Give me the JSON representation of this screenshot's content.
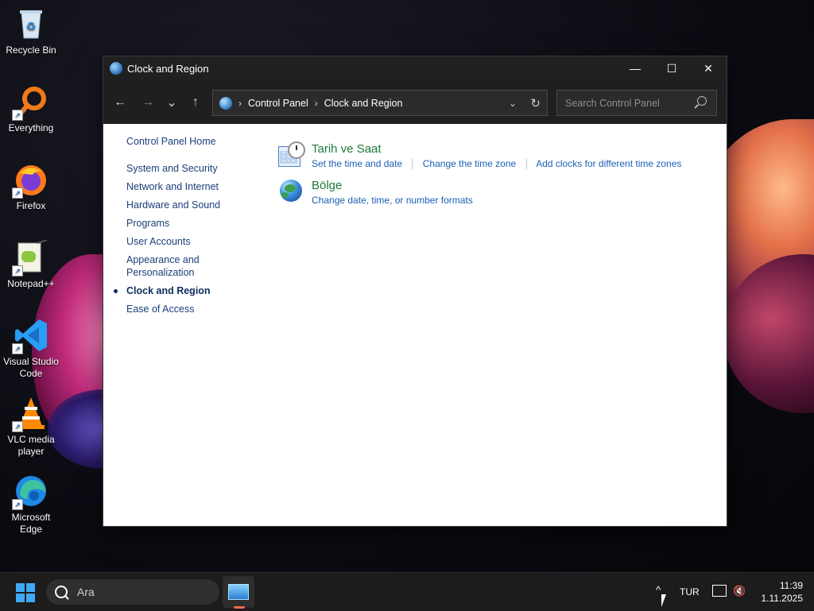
{
  "desktop": {
    "icons": [
      {
        "label": "Recycle Bin",
        "icon": "recycle-bin-icon"
      },
      {
        "label": "Everything",
        "icon": "everything-search-icon"
      },
      {
        "label": "Firefox",
        "icon": "firefox-icon"
      },
      {
        "label": "Notepad++",
        "icon": "notepadpp-icon"
      },
      {
        "label": "Visual Studio Code",
        "icon": "vscode-icon"
      },
      {
        "label": "VLC media player",
        "icon": "vlc-icon"
      },
      {
        "label": "Microsoft Edge",
        "icon": "edge-icon"
      }
    ]
  },
  "window": {
    "title": "Clock and Region",
    "controls": {
      "minimize": "—",
      "maximize": "☐",
      "close": "✕"
    }
  },
  "navbar": {
    "back": "←",
    "forward": "→",
    "recent": "⌄",
    "up": "↑",
    "breadcrumb": [
      "Control Panel",
      "Clock and Region"
    ],
    "separator": "›",
    "search_placeholder": "Search Control Panel"
  },
  "sidebar": {
    "home": "Control Panel Home",
    "items": [
      {
        "label": "System and Security",
        "current": false
      },
      {
        "label": "Network and Internet",
        "current": false
      },
      {
        "label": "Hardware and Sound",
        "current": false
      },
      {
        "label": "Programs",
        "current": false
      },
      {
        "label": "User Accounts",
        "current": false
      },
      {
        "label": "Appearance and Personalization",
        "current": false
      },
      {
        "label": "Clock and Region",
        "current": true
      },
      {
        "label": "Ease of Access",
        "current": false
      }
    ]
  },
  "categories": [
    {
      "title": "Tarih ve Saat",
      "icon": "date-time-icon",
      "links": [
        "Set the time and date",
        "Change the time zone",
        "Add clocks for different time zones"
      ]
    },
    {
      "title": "Bölge",
      "icon": "region-globe-icon",
      "links": [
        "Change date, time, or number formats"
      ]
    }
  ],
  "taskbar": {
    "search_label": "Ara",
    "tray_chevron": "^",
    "language": "TUR",
    "time": "11:39",
    "date": "1.11.2025"
  }
}
